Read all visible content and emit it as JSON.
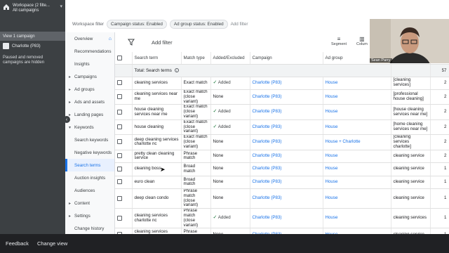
{
  "account": {
    "workspace_line1": "Workspace (2 filte...",
    "workspace_line2": "All campaigns",
    "view_label": "View 1 campaign",
    "campaign_name": "Charlotte (P83)",
    "note": "Paused and removed campaigns are hidden"
  },
  "footer": {
    "feedback": "Feedback",
    "change_view": "Change view"
  },
  "topbar": {
    "label": "Workspace filter",
    "chip1": "Campaign status: Enabled",
    "chip2": "Ad group status: Enabled",
    "add_filter": "Add filter"
  },
  "nav": {
    "items": [
      {
        "label": "Overview"
      },
      {
        "label": "Recommendations"
      },
      {
        "label": "Insights"
      },
      {
        "label": "Campaigns"
      },
      {
        "label": "Ad groups"
      },
      {
        "label": "Ads and assets"
      },
      {
        "label": "Landing pages"
      },
      {
        "label": "Keywords"
      },
      {
        "label": "Search keywords"
      },
      {
        "label": "Negative keywords"
      },
      {
        "label": "Search terms"
      },
      {
        "label": "Auction insights"
      },
      {
        "label": "Audiences"
      },
      {
        "label": "Content"
      },
      {
        "label": "Settings"
      },
      {
        "label": "Change history"
      }
    ]
  },
  "toolbar": {
    "add_filter": "Add filter",
    "segment": "Segment",
    "columns": "Colum"
  },
  "table": {
    "headers": [
      "Search term",
      "Match type",
      "Added/Excluded",
      "Campaign",
      "Ad group",
      ""
    ],
    "total_label": "Total: Search terms",
    "total_num": "57",
    "rows": [
      {
        "term": "cleaning services",
        "match": "Exact match",
        "added": "Added",
        "campaign": "Charlotte (P83)",
        "adgroup": "House",
        "kw": "[cleaning services]",
        "n": "2"
      },
      {
        "term": "cleaning services near me",
        "match": "Exact match (close variant)",
        "added": "None",
        "campaign": "Charlotte (P83)",
        "adgroup": "House",
        "kw": "[professional house cleaning]",
        "n": "2"
      },
      {
        "term": "house cleaning services near me",
        "match": "Exact match (close variant)",
        "added": "Added",
        "campaign": "Charlotte (P83)",
        "adgroup": "House",
        "kw": "[house cleaning services near me]",
        "n": "2"
      },
      {
        "term": "house cleaning",
        "match": "Exact match (close variant)",
        "added": "Added",
        "campaign": "Charlotte (P83)",
        "adgroup": "House",
        "kw": "[home cleaning services near me]",
        "n": "2"
      },
      {
        "term": "deep cleaning services charlotte nc",
        "match": "Exact match (close variant)",
        "added": "None",
        "campaign": "Charlotte (P83)",
        "adgroup": "House + Charlotte",
        "kw": "[cleaning services charlotte]",
        "n": "2"
      },
      {
        "term": "pretty clean cleaning service",
        "match": "Phrase match",
        "added": "None",
        "campaign": "Charlotte (P83)",
        "adgroup": "House",
        "kw": "cleaning service",
        "n": "2"
      },
      {
        "term": "cleaning boss",
        "match": "Broad match",
        "added": "None",
        "campaign": "Charlotte (P83)",
        "adgroup": "House",
        "kw": "cleaning service",
        "n": "1"
      },
      {
        "term": "euro clean",
        "match": "Broad match",
        "added": "None",
        "campaign": "Charlotte (P83)",
        "adgroup": "House",
        "kw": "cleaning service",
        "n": "1"
      },
      {
        "term": "deep clean condo",
        "match": "Phrase match (close variant)",
        "added": "None",
        "campaign": "Charlotte (P83)",
        "adgroup": "House",
        "kw": "cleaning service",
        "n": "1"
      },
      {
        "term": "cleaning services charlotte nc",
        "match": "Phrase match (close variant)",
        "added": "Added",
        "campaign": "Charlotte (P83)",
        "adgroup": "House",
        "kw": "cleaning services",
        "n": "1"
      },
      {
        "term": "cleaning services cornelius nc",
        "match": "Phrase match",
        "added": "None",
        "campaign": "Charlotte (P83)",
        "adgroup": "House",
        "kw": "cleaning service",
        "n": "1"
      }
    ]
  },
  "cam": {
    "name": "Sean Parry"
  },
  "icons": {
    "home": "home-icon",
    "filter": "filter-icon",
    "segment": "segment-icon",
    "columns": "columns-icon"
  },
  "colors": {
    "accent": "#1a73e8",
    "sidebar": "#3c4043",
    "added": "#137333"
  }
}
